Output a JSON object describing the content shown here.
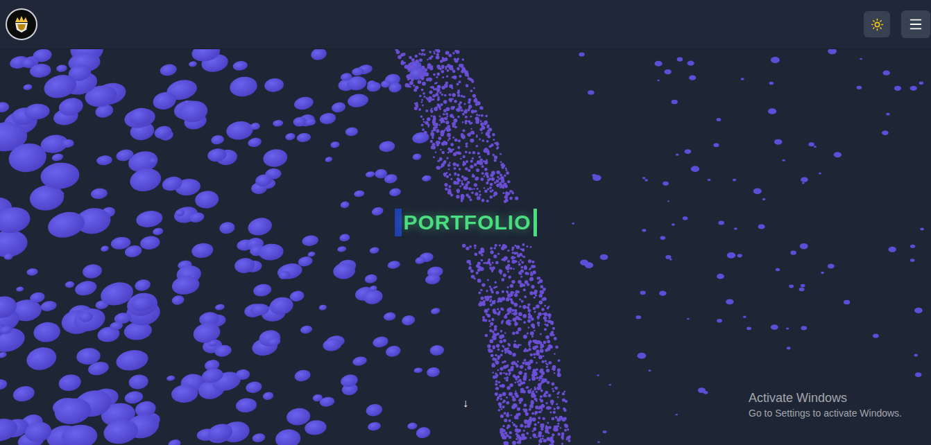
{
  "hero": {
    "title": "PORTFOLIO",
    "scroll_hint": "↓"
  },
  "watermark": {
    "title": "Activate Windows",
    "subtitle": "Go to Settings to activate Windows."
  }
}
